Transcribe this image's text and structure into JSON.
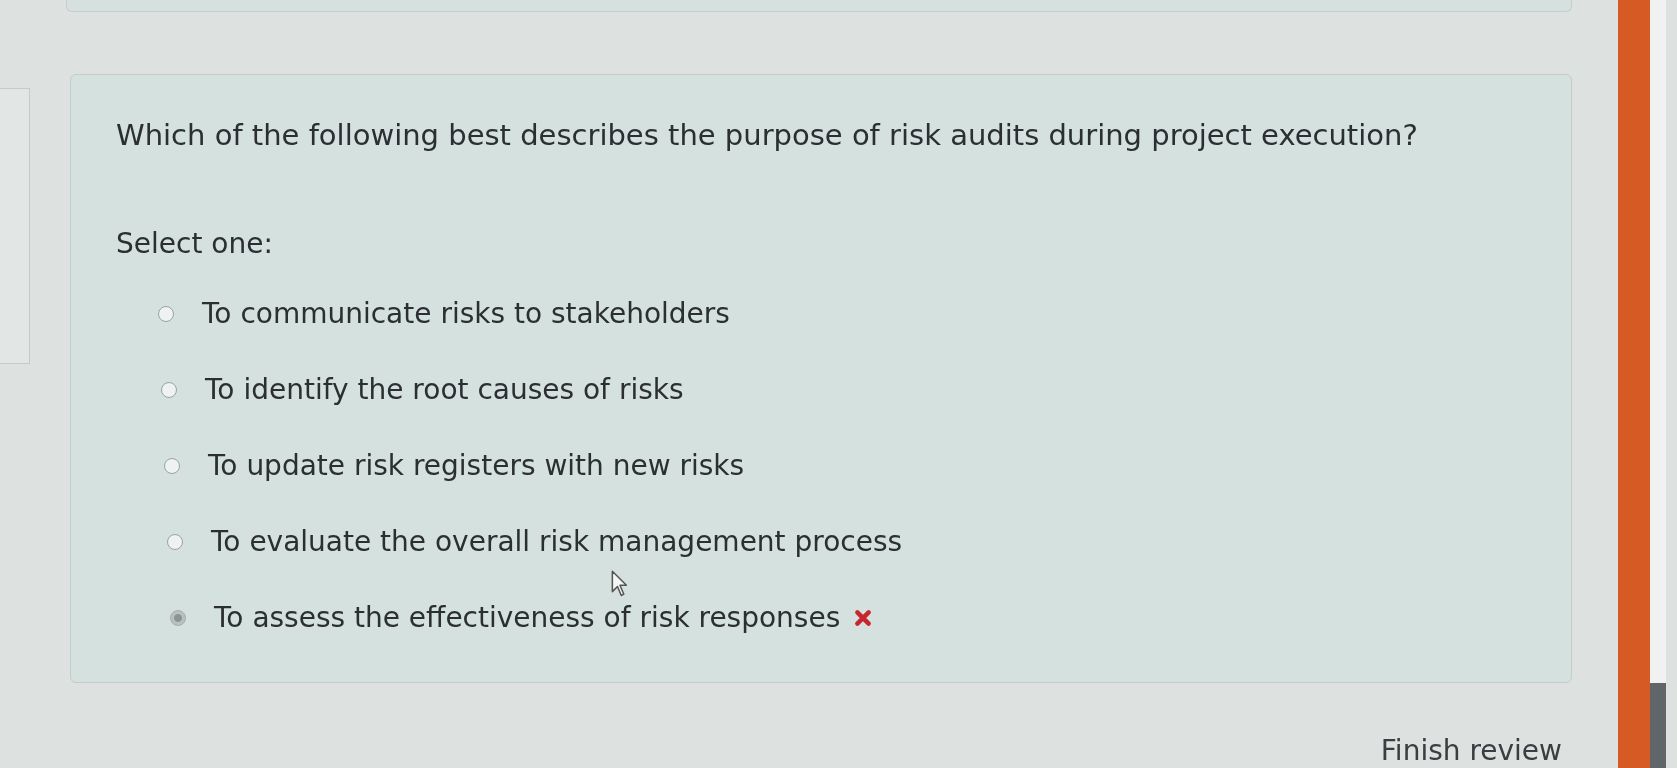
{
  "question": {
    "text": "Which of the following best describes the purpose of risk audits during project execution?",
    "prompt": "Select one:",
    "options": [
      {
        "label": "To communicate risks to stakeholders",
        "selected": false,
        "incorrect": false
      },
      {
        "label": "To identify the root causes of risks",
        "selected": false,
        "incorrect": false
      },
      {
        "label": "To update risk registers with new risks",
        "selected": false,
        "incorrect": false
      },
      {
        "label": "To evaluate the overall risk management process",
        "selected": false,
        "incorrect": false
      },
      {
        "label": "To assess the effectiveness of risk responses",
        "selected": true,
        "incorrect": true
      }
    ]
  },
  "footer": {
    "link": "Finish review"
  }
}
